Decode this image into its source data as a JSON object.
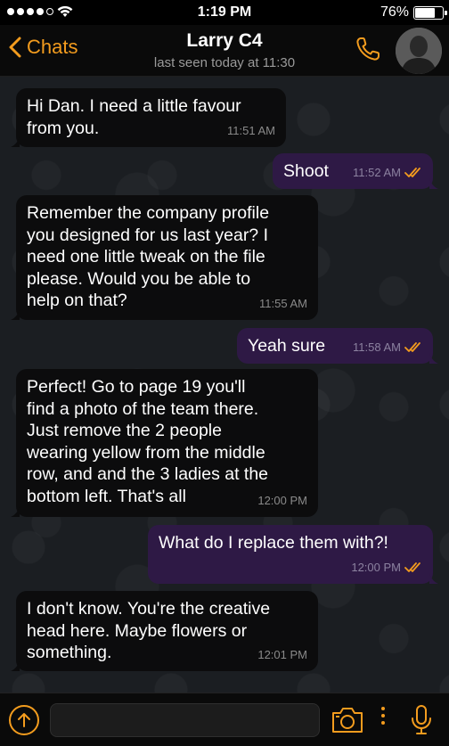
{
  "status": {
    "time": "1:19 PM",
    "battery_percent": "76%",
    "battery_level": 0.76
  },
  "header": {
    "back_label": "Chats",
    "title": "Larry C4",
    "subtitle": "last seen today at 11:30"
  },
  "messages": [
    {
      "dir": "in",
      "text": "Hi Dan. I need a little favour\nfrom you.",
      "time": "11:51 AM"
    },
    {
      "dir": "out",
      "text": "Shoot",
      "time": "11:52 AM",
      "read": true
    },
    {
      "dir": "in",
      "text": "Remember the company profile\nyou designed for us last year? I\nneed one little tweak on the file\nplease. Would you be able to\nhelp on that?",
      "time": "11:55 AM"
    },
    {
      "dir": "out",
      "text": "Yeah sure",
      "time": "11:58 AM",
      "read": true
    },
    {
      "dir": "in",
      "text": "Perfect! Go to page 19 you'll\nfind a photo of the team there.\nJust remove the 2 people\nwearing yellow from the middle\nrow, and and the 3 ladies at the\nbottom left. That's all",
      "time": "12:00 PM"
    },
    {
      "dir": "out",
      "text": "What do I replace them with?!",
      "time": "12:00 PM",
      "read": true
    },
    {
      "dir": "in",
      "text": "I don't know. You're the creative\nhead here. Maybe flowers or\nsomething.",
      "time": "12:01 PM"
    }
  ],
  "input": {
    "value": "",
    "placeholder": ""
  },
  "colors": {
    "accent": "#f39c1e",
    "incoming_bubble": "#0c0c0d",
    "outgoing_bubble": "#2e1945",
    "background": "#1b1e22"
  },
  "icons": [
    "wifi-icon",
    "chevron-left-icon",
    "phone-icon",
    "avatar",
    "attach-icon",
    "camera-icon",
    "more-icon",
    "microphone-icon",
    "double-check-icon"
  ]
}
